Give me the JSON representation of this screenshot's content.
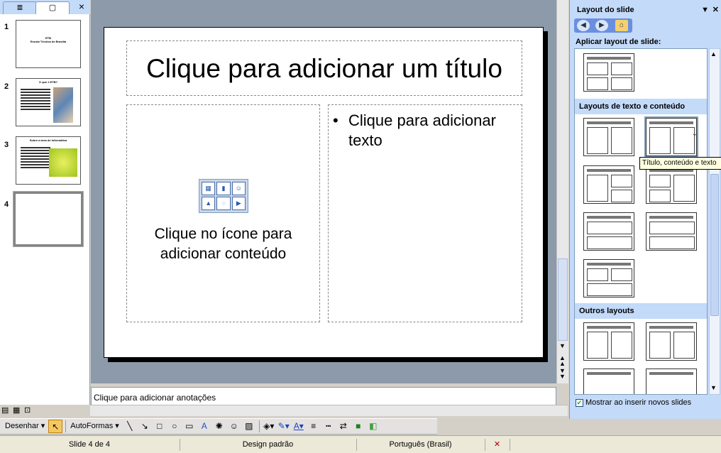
{
  "left_pane": {
    "tabs": [
      "outline-tab",
      "slides-tab"
    ],
    "close": "×",
    "slides": [
      {
        "num": "1",
        "title": "ETB\nEscola Técnica de Brasília",
        "lines": 0
      },
      {
        "num": "2",
        "title": "O que é ETB?",
        "lines": 10
      },
      {
        "num": "3",
        "title": "Sobre a área de Informática",
        "lines": 10
      },
      {
        "num": "4",
        "title": "",
        "lines": 0
      }
    ]
  },
  "slide": {
    "title": "Clique para adicionar um título",
    "bullet": "Clique para adicionar texto",
    "content_hint": "Clique no ícone para adicionar conteúdo"
  },
  "notes": {
    "placeholder": "Clique para adicionar anotações"
  },
  "task_pane": {
    "title": "Layout do slide",
    "apply_label": "Aplicar layout de slide:",
    "category_text_content": "Layouts de texto e conteúdo",
    "category_other": "Outros layouts",
    "tooltip": "Título, conteúdo e texto",
    "show_on_insert": "Mostrar ao inserir novos slides",
    "show_on_insert_checked": true
  },
  "drawing_toolbar": {
    "draw_label": "Desenhar",
    "autoshapes_label": "AutoFormas"
  },
  "status_bar": {
    "slide_info": "Slide 4 de 4",
    "design": "Design padrão",
    "language": "Português (Brasil)"
  }
}
